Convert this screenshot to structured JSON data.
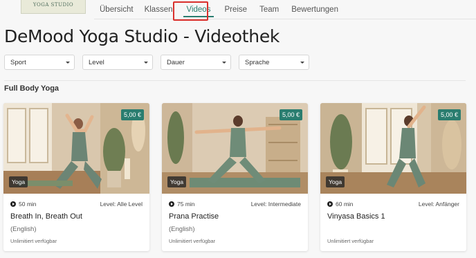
{
  "header": {
    "logo_text": "YOGA STUDIO",
    "tabs": [
      {
        "label": "Übersicht"
      },
      {
        "label": "Klassen"
      },
      {
        "label": "Videos"
      },
      {
        "label": "Preise"
      },
      {
        "label": "Team"
      },
      {
        "label": "Bewertungen"
      }
    ],
    "active_tab": "Videos"
  },
  "page": {
    "title": "DeMood Yoga Studio - Videothek"
  },
  "filters": [
    {
      "label": "Sport"
    },
    {
      "label": "Level"
    },
    {
      "label": "Dauer"
    },
    {
      "label": "Sprache"
    }
  ],
  "section": {
    "title": "Full Body Yoga"
  },
  "cards": [
    {
      "price": "5,00 €",
      "category": "Yoga",
      "duration": "50 min",
      "level": "Level: Alle Level",
      "title": "Breath In, Breath Out",
      "language": "(English)",
      "availability": "Unlimitiert verfügbar"
    },
    {
      "price": "5,00 €",
      "category": "Yoga",
      "duration": "75 min",
      "level": "Level: Intermediate",
      "title": "Prana Practise",
      "language": "(English)",
      "availability": "Unlimitiert verfügbar"
    },
    {
      "price": "5,00 €",
      "category": "Yoga",
      "duration": "60 min",
      "level": "Level: Anfänger",
      "title": "Vinyasa Basics 1",
      "language": "",
      "availability": "Unlimitiert verfügbar"
    }
  ],
  "colors": {
    "accent": "#2a7d6f",
    "highlight_box": "#d9302c",
    "background": "#f7f7f7"
  }
}
